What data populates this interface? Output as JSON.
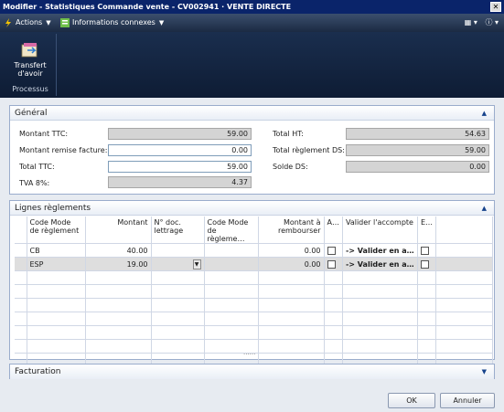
{
  "window": {
    "title": "Modifier - Statistiques Commande vente - CV002941 · VENTE DIRECTE"
  },
  "cmdbar": {
    "actions": "Actions",
    "related": "Informations connexes"
  },
  "ribbon": {
    "transfer_label": "Transfert d'avoir",
    "group_label": "Processus"
  },
  "general": {
    "title": "Général",
    "montant_ttc_label": "Montant TTC:",
    "montant_ttc": "59.00",
    "remise_label": "Montant remise facture:",
    "remise": "0.00",
    "total_ttc_label": "Total TTC:",
    "total_ttc": "59.00",
    "tva_label": "TVA 8%:",
    "tva": "4.37",
    "total_ht_label": "Total HT:",
    "total_ht": "54.63",
    "total_reglement_label": "Total règlement DS:",
    "total_reglement": "59.00",
    "solde_label": "Solde DS:",
    "solde": "0.00"
  },
  "lines": {
    "title": "Lignes règlements",
    "headers": [
      "Code Mode de règlement",
      "Montant",
      "N° doc. lettrage",
      "Code Mode de règleme…",
      "Montant à rembourser",
      "A…",
      "Valider l'accompte",
      "E…"
    ],
    "rows": [
      {
        "code": "CB",
        "montant": "40.00",
        "doc": "",
        "code2": "",
        "rembourser": "0.00",
        "valider": "-> Valider en a…"
      },
      {
        "code": "ESP",
        "montant": "19.00",
        "doc": "",
        "code2": "",
        "rembourser": "0.00",
        "valider": "-> Valider en a…"
      }
    ]
  },
  "facturation": {
    "title": "Facturation"
  },
  "footer": {
    "ok": "OK",
    "cancel": "Annuler"
  },
  "colors": {
    "titlebar": "#0a246a",
    "ribbon": "#1a2e4e",
    "panel_border": "#9aaccc"
  }
}
